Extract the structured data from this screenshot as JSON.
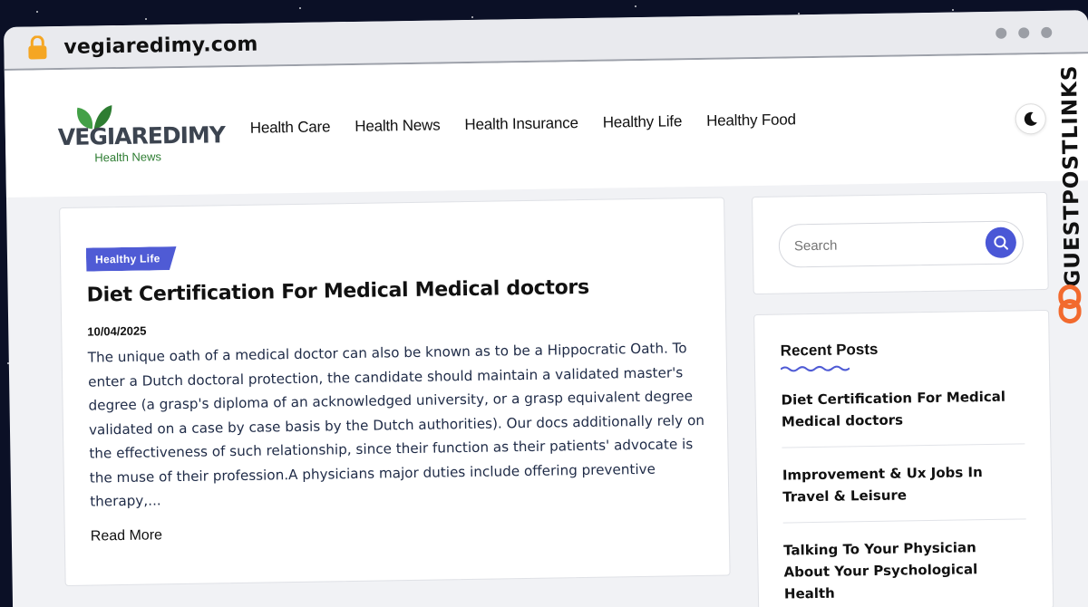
{
  "browser": {
    "url": "vegiaredimy.com"
  },
  "site": {
    "logo_text": "VEGIAREDIMY",
    "logo_subtitle": "Health News",
    "nav": [
      "Health Care",
      "Health News",
      "Health Insurance",
      "Healthy Life",
      "Healthy Food"
    ],
    "theme_icon": "moon-icon"
  },
  "post": {
    "category": "Healthy Life",
    "title": "Diet Certification For Medical Medical doctors",
    "date": "10/04/2025",
    "excerpt": "The unique oath of a medical doctor can also be known as to be a Hippocratic Oath. To enter a Dutch doctoral protection, the candidate should maintain a validated master's degree (a grasp's diploma of an acknowledged university, or a grasp equivalent degree validated on a case by case basis by the Dutch authorities). Our docs additionally rely on the effectiveness of such relationship, since their function as their patients' advocate is the muse of their profession.A physicians major duties include offering preventive therapy,...",
    "read_more": "Read More"
  },
  "sidebar": {
    "search_placeholder": "Search",
    "recent_title": "Recent Posts",
    "recent_posts": [
      "Diet Certification For Medical Medical doctors",
      "Improvement & Ux Jobs In Travel & Leisure",
      "Talking To Your Physician About Your Psychological Health"
    ]
  },
  "watermark": {
    "text": "GUESTPOSTLINKS"
  },
  "colors": {
    "accent": "#4f5bd5",
    "leaf_green": "#2e7d32",
    "watermark_orange": "#f26a2e"
  }
}
